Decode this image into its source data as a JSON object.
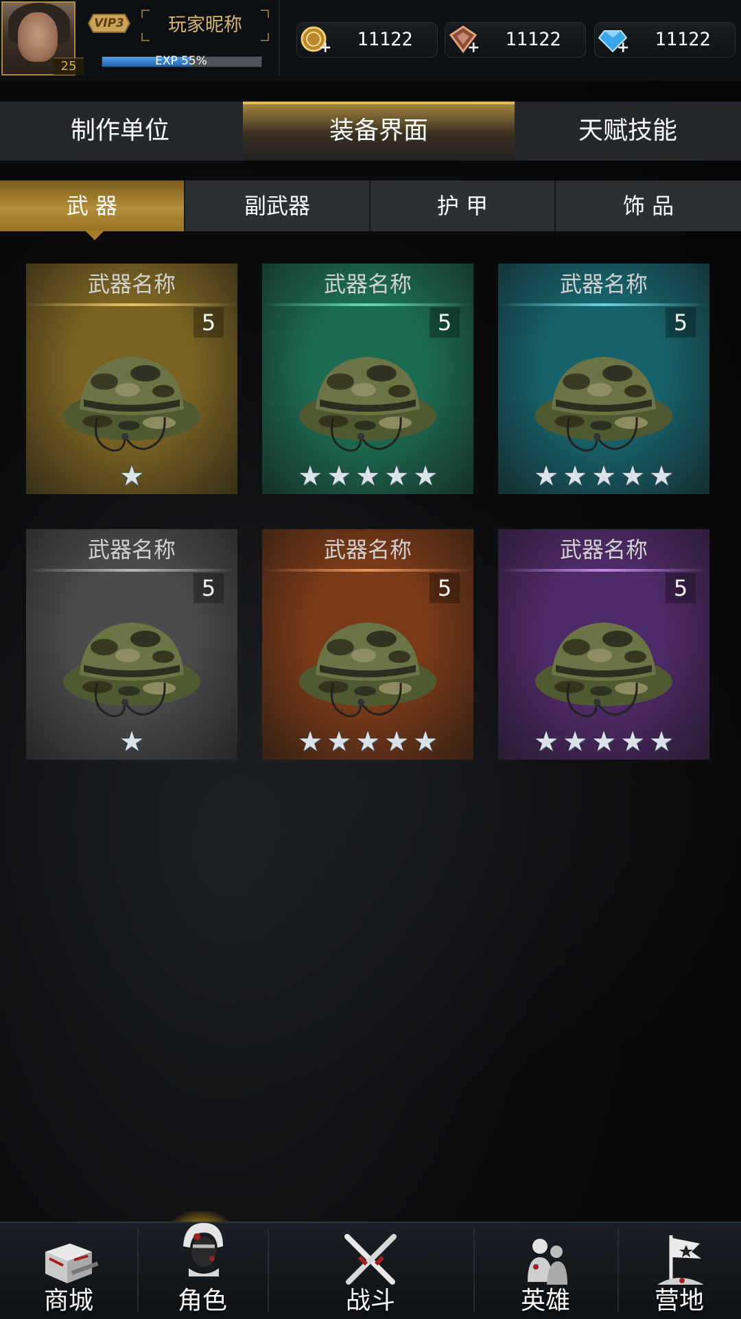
{
  "player": {
    "level": "25",
    "vip": "VIP3",
    "nickname": "玩家昵称",
    "exp_text": "EXP 55%",
    "exp_percent": 55
  },
  "currencies": [
    {
      "icon": "gold-coin-icon",
      "value": "11122"
    },
    {
      "icon": "badge-token-icon",
      "value": "11122"
    },
    {
      "icon": "diamond-icon",
      "value": "11122"
    }
  ],
  "main_tabs": [
    {
      "label": "制作单位",
      "active": false
    },
    {
      "label": "装备界面",
      "active": true
    },
    {
      "label": "天赋技能",
      "active": false
    }
  ],
  "sub_tabs": [
    {
      "label": "武 器",
      "active": true
    },
    {
      "label": "副武器",
      "active": false
    },
    {
      "label": "护 甲",
      "active": false
    },
    {
      "label": "饰 品",
      "active": false
    }
  ],
  "cards": [
    {
      "title": "武器名称",
      "count": "5",
      "stars": 1,
      "rarity": "gold",
      "bg": "#7a6322",
      "divider": "#e8c66b"
    },
    {
      "title": "武器名称",
      "count": "5",
      "stars": 5,
      "rarity": "green",
      "bg": "#1c6a52",
      "divider": "#69d9b0"
    },
    {
      "title": "武器名称",
      "count": "5",
      "stars": 5,
      "rarity": "cyan",
      "bg": "#17626a",
      "divider": "#6fd3dc"
    },
    {
      "title": "武器名称",
      "count": "5",
      "stars": 1,
      "rarity": "gray",
      "bg": "#4a4b4c",
      "divider": "#b7b9bb"
    },
    {
      "title": "武器名称",
      "count": "5",
      "stars": 5,
      "rarity": "orange",
      "bg": "#7a3a18",
      "divider": "#e7955c"
    },
    {
      "title": "武器名称",
      "count": "5",
      "stars": 5,
      "rarity": "purple",
      "bg": "#4f2a68",
      "divider": "#c38be2"
    }
  ],
  "bottom_nav": [
    {
      "label": "商城",
      "icon": "shop-crate-icon",
      "active": false
    },
    {
      "label": "角色",
      "icon": "soldier-helmet-icon",
      "active": true
    },
    {
      "label": "战斗",
      "icon": "crossed-rifles-icon",
      "active": false
    },
    {
      "label": "英雄",
      "icon": "hero-soldiers-icon",
      "active": false
    },
    {
      "label": "营地",
      "icon": "camp-flag-icon",
      "active": false
    }
  ]
}
